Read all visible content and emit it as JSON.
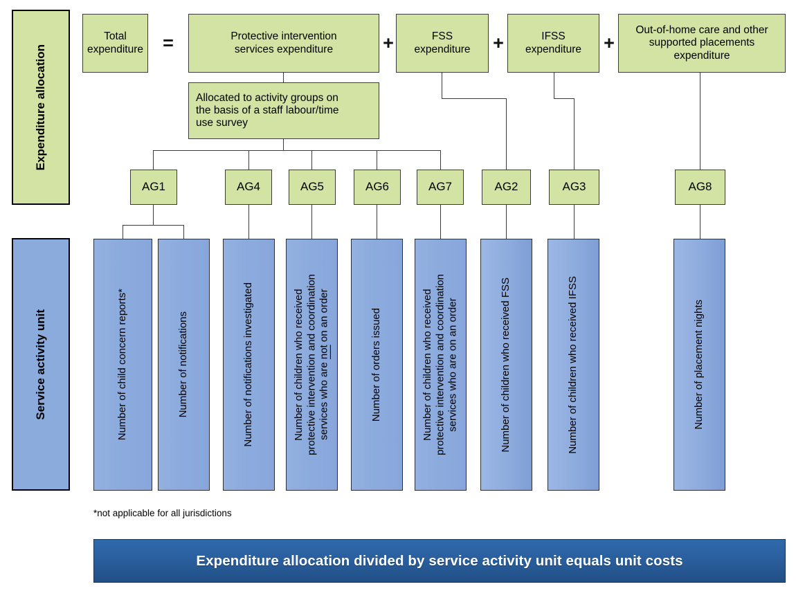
{
  "row_labels": {
    "expenditure": "Expenditure allocation",
    "service": "Service activity unit"
  },
  "equation": {
    "total": "Total\nexpenditure",
    "equals": "=",
    "plus": "+",
    "terms": [
      "Protective intervention\nservices expenditure",
      "FSS\nexpenditure",
      "IFSS\nexpenditure",
      "Out-of-home care and other\nsupported placements\nexpenditure"
    ]
  },
  "allocation_note": "Allocated to activity groups on\nthe basis of a staff labour/time\nuse survey",
  "activity_groups": [
    {
      "id": "ag1",
      "label": "AG1"
    },
    {
      "id": "ag4",
      "label": "AG4"
    },
    {
      "id": "ag5",
      "label": "AG5"
    },
    {
      "id": "ag6",
      "label": "AG6"
    },
    {
      "id": "ag7",
      "label": "AG7"
    },
    {
      "id": "ag2",
      "label": "AG2"
    },
    {
      "id": "ag3",
      "label": "AG3"
    },
    {
      "id": "ag8",
      "label": "AG8"
    }
  ],
  "service_units": [
    {
      "id": "su1",
      "label": "Number of child concern reports*"
    },
    {
      "id": "su2",
      "label": "Number of notifications"
    },
    {
      "id": "su3",
      "label": "Number of notifications investigated"
    },
    {
      "id": "su4",
      "label": "Number of children who received\nprotective intervention and coordination\nservices who are not on an order",
      "underline_word": "not"
    },
    {
      "id": "su5",
      "label": "Number of orders issued"
    },
    {
      "id": "su6",
      "label": "Number of children who received\nprotective intervention and coordination\nservices who are on an order"
    },
    {
      "id": "su7",
      "label": "Number of children who received FSS"
    },
    {
      "id": "su8",
      "label": "Number of children who received IFSS"
    },
    {
      "id": "su9",
      "label": "Number of placement nights"
    }
  ],
  "footnote": "*not applicable for all jurisdictions",
  "bottom_banner": "Expenditure allocation divided by service activity unit equals unit costs",
  "colors": {
    "green_fill": "#d2e3a4",
    "blue_fill": "#8cabdd",
    "banner_blue": "#2a5f9e",
    "line": "#3a3a3a",
    "border": "#2f2f2f"
  }
}
